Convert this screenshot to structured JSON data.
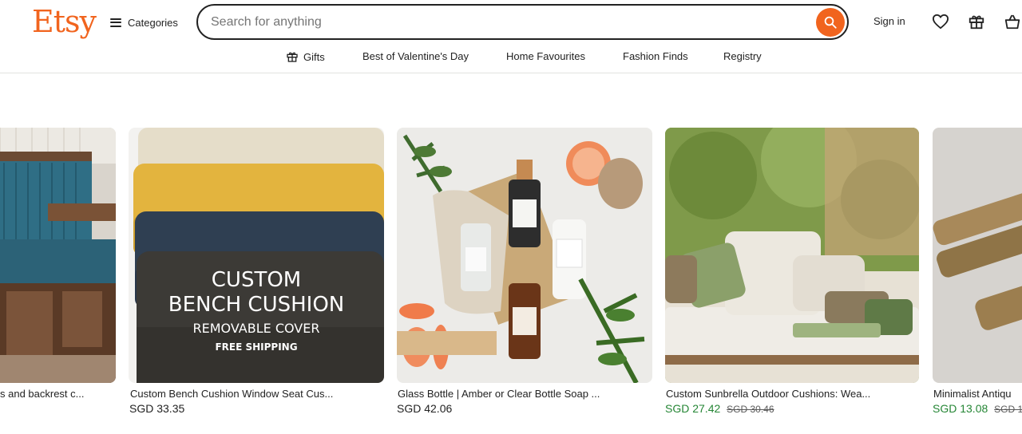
{
  "header": {
    "logo": "Etsy",
    "categories_label": "Categories",
    "search_placeholder": "Search for anything",
    "signin_label": "Sign in"
  },
  "nav": {
    "items": [
      "Gifts",
      "Best of Valentine's Day",
      "Home Favourites",
      "Fashion Finds",
      "Registry"
    ]
  },
  "listings": [
    {
      "title": "s and backrest c...",
      "price": ""
    },
    {
      "title": "Custom Bench Cushion Window Seat Cus...",
      "price": "SGD 33.35",
      "overlay": [
        "CUSTOM",
        "BENCH CUSHION",
        "REMOVABLE COVER",
        "FREE SHIPPING"
      ]
    },
    {
      "title": "Glass Bottle | Amber or Clear Bottle Soap ...",
      "price": "SGD 42.06"
    },
    {
      "title": "Custom Sunbrella Outdoor Cushions: Wea...",
      "price": "SGD 27.42",
      "original_price": "SGD 30.46"
    },
    {
      "title": "Minimalist Antiqu",
      "price": "SGD 13.08",
      "original_price": "SGD 1"
    }
  ],
  "colors": {
    "brand": "#f1641e",
    "sale": "#258635",
    "text": "#222222"
  }
}
